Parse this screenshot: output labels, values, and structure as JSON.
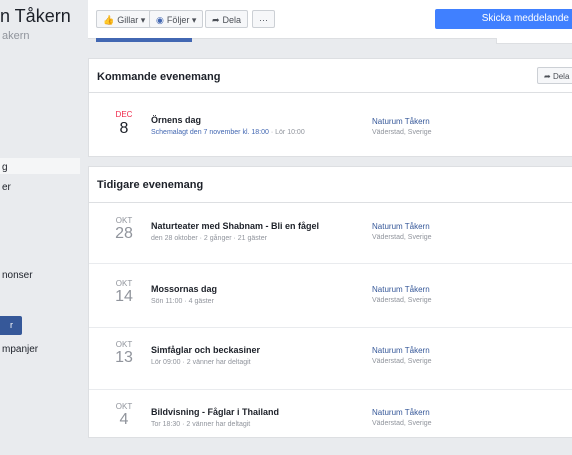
{
  "page": {
    "name": "n Tåkern",
    "handle": "akern"
  },
  "sidebar": {
    "items": [
      {
        "label": "g"
      },
      {
        "label": "er"
      },
      {
        "label": "nonser"
      },
      {
        "label": "r"
      },
      {
        "label": "mpanjer"
      }
    ]
  },
  "toolbar": {
    "like_label": "Gillar ▾",
    "follow_label": "Följer ▾",
    "share_label": "Dela",
    "more_label": "···",
    "send_message_label": "Skicka meddelande"
  },
  "upcoming": {
    "title": "Kommande evenemang",
    "share_label": "Dela",
    "events": [
      {
        "month": "DEC",
        "day": "8",
        "title": "Örnens dag",
        "meta_link": "Schemalagt den 7 november kl. 18:00",
        "meta_rest": " · Lör 10:00",
        "host": "Naturum Tåkern",
        "location": "Väderstad, Sverige"
      }
    ]
  },
  "past": {
    "title": "Tidigare evenemang",
    "events": [
      {
        "month": "OKT",
        "day": "28",
        "title": "Naturteater med Shabnam - Bli en fågel",
        "meta": "den 28 oktober · 2 gånger · 21 gäster",
        "host": "Naturum Tåkern",
        "location": "Väderstad, Sverige"
      },
      {
        "month": "OKT",
        "day": "14",
        "title": "Mossornas dag",
        "meta": "Sön 11:00 · 4 gäster",
        "host": "Naturum Tåkern",
        "location": "Väderstad, Sverige"
      },
      {
        "month": "OKT",
        "day": "13",
        "title": "Simfåglar och beckasiner",
        "meta": "Lör 09:00 · 2 vänner har deltagit",
        "host": "Naturum Tåkern",
        "location": "Väderstad, Sverige"
      },
      {
        "month": "OKT",
        "day": "4",
        "title": "Bildvisning - Fåglar i Thailand",
        "meta": "Tor 18:30 · 2 vänner har deltagit",
        "host": "Naturum Tåkern",
        "location": "Väderstad, Sverige"
      }
    ]
  },
  "colors": {
    "accent": "#4267b2",
    "send_button": "#4080ff",
    "upcoming_month": "#f02849"
  }
}
